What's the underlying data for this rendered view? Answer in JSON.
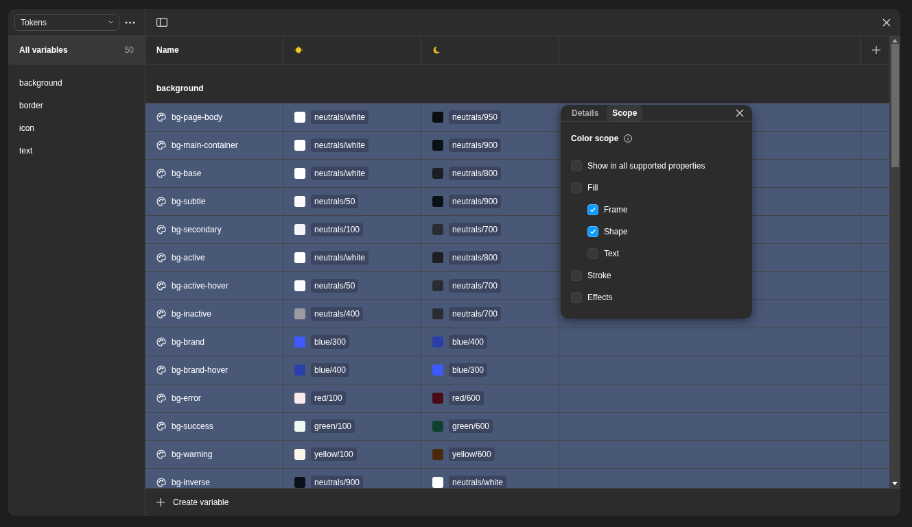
{
  "collection_select": {
    "value": "Tokens"
  },
  "sidebar": {
    "all": {
      "label": "All variables",
      "count": "50",
      "selected": true
    },
    "groups": [
      {
        "label": "background",
        "selected": false
      },
      {
        "label": "border",
        "selected": false
      },
      {
        "label": "icon",
        "selected": false
      },
      {
        "label": "text",
        "selected": false
      }
    ]
  },
  "table": {
    "columns": [
      {
        "kind": "text",
        "label": "Name"
      },
      {
        "kind": "light"
      },
      {
        "kind": "dark"
      }
    ],
    "group_heading": "background",
    "rows": [
      {
        "name": "bg-page-body",
        "selected": true,
        "light": {
          "label": "neutrals/white",
          "color": "#ffffff"
        },
        "dark": {
          "label": "neutrals/950",
          "color": "#0a0c10"
        }
      },
      {
        "name": "bg-main-container",
        "selected": true,
        "light": {
          "label": "neutrals/white",
          "color": "#ffffff"
        },
        "dark": {
          "label": "neutrals/900",
          "color": "#0c1018"
        }
      },
      {
        "name": "bg-base",
        "selected": true,
        "light": {
          "label": "neutrals/white",
          "color": "#ffffff"
        },
        "dark": {
          "label": "neutrals/800",
          "color": "#1c1e24"
        }
      },
      {
        "name": "bg-subtle",
        "selected": true,
        "light": {
          "label": "neutrals/50",
          "color": "#fafafa"
        },
        "dark": {
          "label": "neutrals/900",
          "color": "#0c1018"
        }
      },
      {
        "name": "bg-secondary",
        "selected": true,
        "light": {
          "label": "neutrals/100",
          "color": "#f5f5f7"
        },
        "dark": {
          "label": "neutrals/700",
          "color": "#2a2c33"
        }
      },
      {
        "name": "bg-active",
        "selected": true,
        "light": {
          "label": "neutrals/white",
          "color": "#ffffff"
        },
        "dark": {
          "label": "neutrals/800",
          "color": "#1c1e24"
        }
      },
      {
        "name": "bg-active-hover",
        "selected": true,
        "light": {
          "label": "neutrals/50",
          "color": "#fafafa"
        },
        "dark": {
          "label": "neutrals/700",
          "color": "#2a2c33"
        }
      },
      {
        "name": "bg-inactive",
        "selected": true,
        "light": {
          "label": "neutrals/400",
          "color": "#9a9ca2"
        },
        "dark": {
          "label": "neutrals/700",
          "color": "#2a2c33"
        }
      },
      {
        "name": "bg-brand",
        "selected": true,
        "light": {
          "label": "blue/300",
          "color": "#3d5afe"
        },
        "dark": {
          "label": "blue/400",
          "color": "#2a3eaa"
        }
      },
      {
        "name": "bg-brand-hover",
        "selected": true,
        "light": {
          "label": "blue/400",
          "color": "#2a3eaa"
        },
        "dark": {
          "label": "blue/300",
          "color": "#3d5afe"
        }
      },
      {
        "name": "bg-error",
        "selected": true,
        "light": {
          "label": "red/100",
          "color": "#fde8ec"
        },
        "dark": {
          "label": "red/600",
          "color": "#4a0a18"
        }
      },
      {
        "name": "bg-success",
        "selected": true,
        "light": {
          "label": "green/100",
          "color": "#eef8f2"
        },
        "dark": {
          "label": "green/600",
          "color": "#0f4030"
        }
      },
      {
        "name": "bg-warning",
        "selected": true,
        "light": {
          "label": "yellow/100",
          "color": "#fdf6ea"
        },
        "dark": {
          "label": "yellow/600",
          "color": "#4a2a0c"
        }
      },
      {
        "name": "bg-inverse",
        "selected": true,
        "light": {
          "label": "neutrals/900",
          "color": "#0c1018"
        },
        "dark": {
          "label": "neutrals/white",
          "color": "#ffffff"
        }
      }
    ]
  },
  "popover": {
    "tabs": [
      {
        "label": "Details",
        "selected": false
      },
      {
        "label": "Scope",
        "selected": true
      }
    ],
    "section_title": "Color scope",
    "options": [
      {
        "label": "Show in all supported properties",
        "checked": false
      },
      {
        "label": "Fill",
        "checked": false,
        "children": [
          {
            "label": "Frame",
            "checked": true
          },
          {
            "label": "Shape",
            "checked": true
          },
          {
            "label": "Text",
            "checked": false
          }
        ]
      },
      {
        "label": "Stroke",
        "checked": false
      },
      {
        "label": "Effects",
        "checked": false
      }
    ]
  },
  "footer": {
    "create_label": "Create variable"
  }
}
